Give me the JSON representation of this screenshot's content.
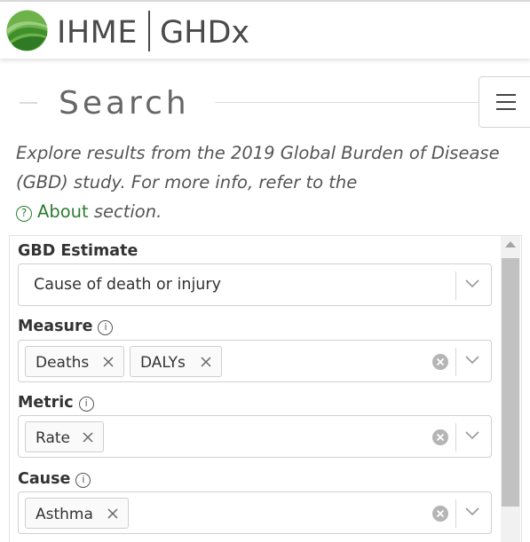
{
  "header": {
    "brand": "IHME",
    "product": "GHDx"
  },
  "search": {
    "title": "Search",
    "intro_text": "Explore results from the 2019 Global Burden of Disease (GBD) study. For more info, refer to the",
    "about_link": "About",
    "intro_suffix": " section.",
    "help_glyph": "?"
  },
  "filters": {
    "gbd_estimate": {
      "label": "GBD Estimate",
      "value": "Cause of death or injury"
    },
    "measure": {
      "label": "Measure",
      "chips": [
        "Deaths",
        "DALYs"
      ]
    },
    "metric": {
      "label": "Metric",
      "chips": [
        "Rate"
      ]
    },
    "cause": {
      "label": "Cause",
      "chips": [
        "Asthma"
      ]
    },
    "info_glyph": "i"
  },
  "colors": {
    "accent_green": "#2e7d32",
    "logo_green": "#5fae45"
  },
  "icons": [
    "ihme-logo-icon",
    "menu-icon",
    "help-circle-icon",
    "info-icon",
    "chevron-down-icon",
    "remove-chip-icon",
    "clear-icon"
  ]
}
